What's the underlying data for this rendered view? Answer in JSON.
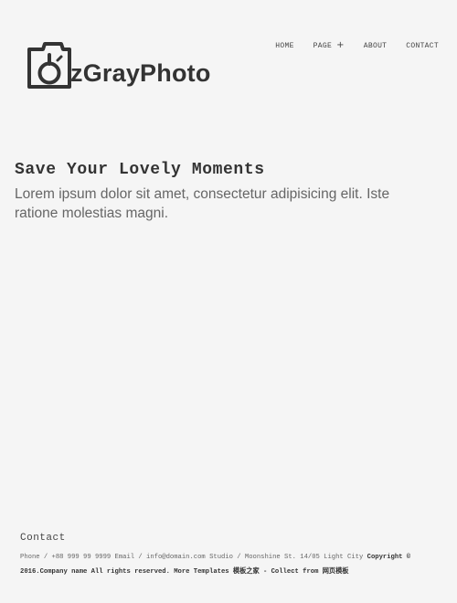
{
  "brand": {
    "name": "zGrayPhoto"
  },
  "nav": {
    "items": [
      {
        "label": "HOME"
      },
      {
        "label": "PAGE",
        "extra": "+"
      },
      {
        "label": "ABOUT"
      },
      {
        "label": "CONTACT"
      }
    ]
  },
  "hero": {
    "title": "Save Your Lovely Moments",
    "description": "Lorem ipsum dolor sit amet, consectetur adipisicing elit. Iste ratione molestias magni."
  },
  "footer": {
    "title": "Contact",
    "phone": "Phone / +88 999 99 9999",
    "email": "Email / info@domain.com",
    "studio": "Studio / Moonshine St. 14/05 Light City",
    "copyright": "Copyright © 2016.Company name All rights reserved.",
    "more_templates": "More Templates 模板之家 - Collect from 网页模板"
  },
  "colors": {
    "background": "#f5f5f5",
    "text": "#333333",
    "muted": "#666666"
  },
  "icons": {
    "logo_icon": "camera-icon",
    "nav_plus": "plus-icon"
  }
}
